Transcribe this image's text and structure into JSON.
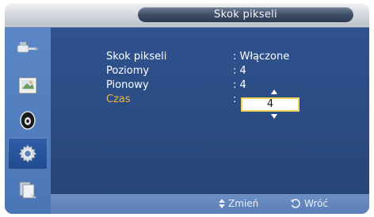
{
  "window": {
    "title": "Skok pikseli"
  },
  "sidebar": {
    "items": [
      {
        "icon": "input-icon"
      },
      {
        "icon": "picture-icon"
      },
      {
        "icon": "sound-icon"
      },
      {
        "icon": "setup-icon",
        "active": true
      },
      {
        "icon": "multi-control-icon"
      }
    ]
  },
  "settings": [
    {
      "label": "Skok pikseli",
      "value": ": Włączone"
    },
    {
      "label": "Poziomy",
      "value": ":  4"
    },
    {
      "label": "Pionowy",
      "value": ":  4"
    },
    {
      "label": "Czas",
      "value": ":",
      "editing": true
    }
  ],
  "editor": {
    "value": "4"
  },
  "footer": {
    "change_label": "Zmień",
    "back_label": "Wróć"
  },
  "colors": {
    "highlight": "#f4b630",
    "editor_border": "#f1d35a"
  }
}
